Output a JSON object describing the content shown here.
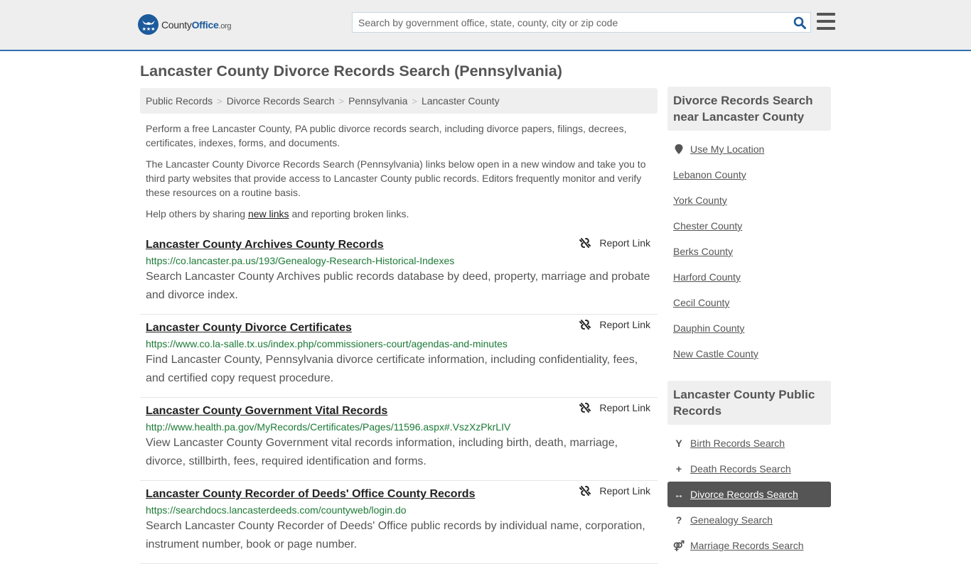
{
  "header": {
    "logo": {
      "part1": "County",
      "part2": "Office",
      "part3": ".org"
    },
    "search": {
      "placeholder": "Search by government office, state, county, city or zip code",
      "value": ""
    }
  },
  "page": {
    "title": "Lancaster County Divorce Records Search (Pennsylvania)"
  },
  "breadcrumb": [
    {
      "label": "Public Records"
    },
    {
      "label": "Divorce Records Search"
    },
    {
      "label": "Pennsylvania"
    },
    {
      "label": "Lancaster County"
    }
  ],
  "breadcrumb_separator": ">",
  "intro": {
    "p1": "Perform a free Lancaster County, PA public divorce records search, including divorce papers, filings, decrees, certificates, indexes, forms, and documents.",
    "p2": "The Lancaster County Divorce Records Search (Pennsylvania) links below open in a new window and take you to third party websites that provide access to Lancaster County public records. Editors frequently monitor and verify these resources on a routine basis.",
    "p3_before": "Help others by sharing ",
    "p3_link": "new links",
    "p3_after": " and reporting broken links."
  },
  "results": [
    {
      "title": "Lancaster County Archives County Records",
      "url": "https://co.lancaster.pa.us/193/Genealogy-Research-Historical-Indexes",
      "description": "Search Lancaster County Archives public records database by deed, property, marriage and probate and divorce index.",
      "report_label": "Report Link"
    },
    {
      "title": "Lancaster County Divorce Certificates",
      "url": "https://www.co.la-salle.tx.us/index.php/commissioners-court/agendas-and-minutes",
      "description": "Find Lancaster County, Pennsylvania divorce certificate information, including confidentiality, fees, and certified copy request procedure.",
      "report_label": "Report Link"
    },
    {
      "title": "Lancaster County Government Vital Records",
      "url": "http://www.health.pa.gov/MyRecords/Certificates/Pages/11596.aspx#.VszXzPkrLIV",
      "description": "View Lancaster County Government vital records information, including birth, death, marriage, divorce, stillbirth, fees, required identification and forms.",
      "report_label": "Report Link"
    },
    {
      "title": "Lancaster County Recorder of Deeds' Office County Records",
      "url": "https://searchdocs.lancasterdeeds.com/countyweb/login.do",
      "description": "Search Lancaster County Recorder of Deeds' Office public records by individual name, corporation, instrument number, book or page number.",
      "report_label": "Report Link"
    }
  ],
  "sidebar": {
    "nearby": {
      "heading": "Divorce Records Search near Lancaster County",
      "use_location": {
        "label": "Use My Location",
        "icon": "map-marker-icon"
      },
      "items": [
        {
          "label": "Lebanon County"
        },
        {
          "label": "York County"
        },
        {
          "label": "Chester County"
        },
        {
          "label": "Berks County"
        },
        {
          "label": "Harford County"
        },
        {
          "label": "Cecil County"
        },
        {
          "label": "Dauphin County"
        },
        {
          "label": "New Castle County"
        }
      ]
    },
    "public_records": {
      "heading": "Lancaster County Public Records",
      "items": [
        {
          "label": "Birth Records Search",
          "icon": "child-icon",
          "glyph": "Y",
          "active": false
        },
        {
          "label": "Death Records Search",
          "icon": "plus-icon",
          "glyph": "+",
          "active": false
        },
        {
          "label": "Divorce Records Search",
          "icon": "arrows-horizontal-icon",
          "glyph": "↔",
          "active": true
        },
        {
          "label": "Genealogy Search",
          "icon": "question-icon",
          "glyph": "?",
          "active": false
        },
        {
          "label": "Marriage Records Search",
          "icon": "marriage-icon",
          "glyph": "⚤",
          "active": false
        }
      ]
    }
  },
  "colors": {
    "brand": "#1c5a9c",
    "topbar_border": "#2f72b0",
    "url_green": "#1c7a36",
    "active_item_bg": "#555555"
  }
}
